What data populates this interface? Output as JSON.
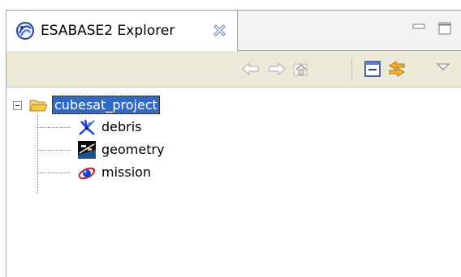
{
  "tab": {
    "title": "ESABASE2 Explorer",
    "icon": "explorer-globe-icon",
    "close_icon": "close-icon"
  },
  "window_controls": {
    "minimize": "minimize-icon",
    "maximize": "maximize-icon"
  },
  "toolbar": {
    "buttons": [
      {
        "icon": "back-arrow-icon",
        "enabled": false
      },
      {
        "icon": "forward-arrow-icon",
        "enabled": false
      },
      {
        "icon": "home-icon",
        "enabled": false
      },
      {
        "icon": "collapse-all-icon",
        "enabled": true
      },
      {
        "icon": "link-with-editor-icon",
        "enabled": true
      },
      {
        "icon": "view-menu-icon",
        "enabled": true
      }
    ]
  },
  "tree": {
    "root": {
      "label": "cubesat_project",
      "icon": "open-folder-icon",
      "expanded": true,
      "selected": true
    },
    "children": [
      {
        "label": "debris",
        "icon": "debris-icon"
      },
      {
        "label": "geometry",
        "icon": "geometry-icon"
      },
      {
        "label": "mission",
        "icon": "mission-icon"
      }
    ]
  },
  "colors": {
    "selection": "#316ac5",
    "toolbar_bg": "#ece9d8",
    "tab_close": "#6b8fc6",
    "disabled_icon": "#b8b8b8",
    "folder": "#f2c94c"
  }
}
